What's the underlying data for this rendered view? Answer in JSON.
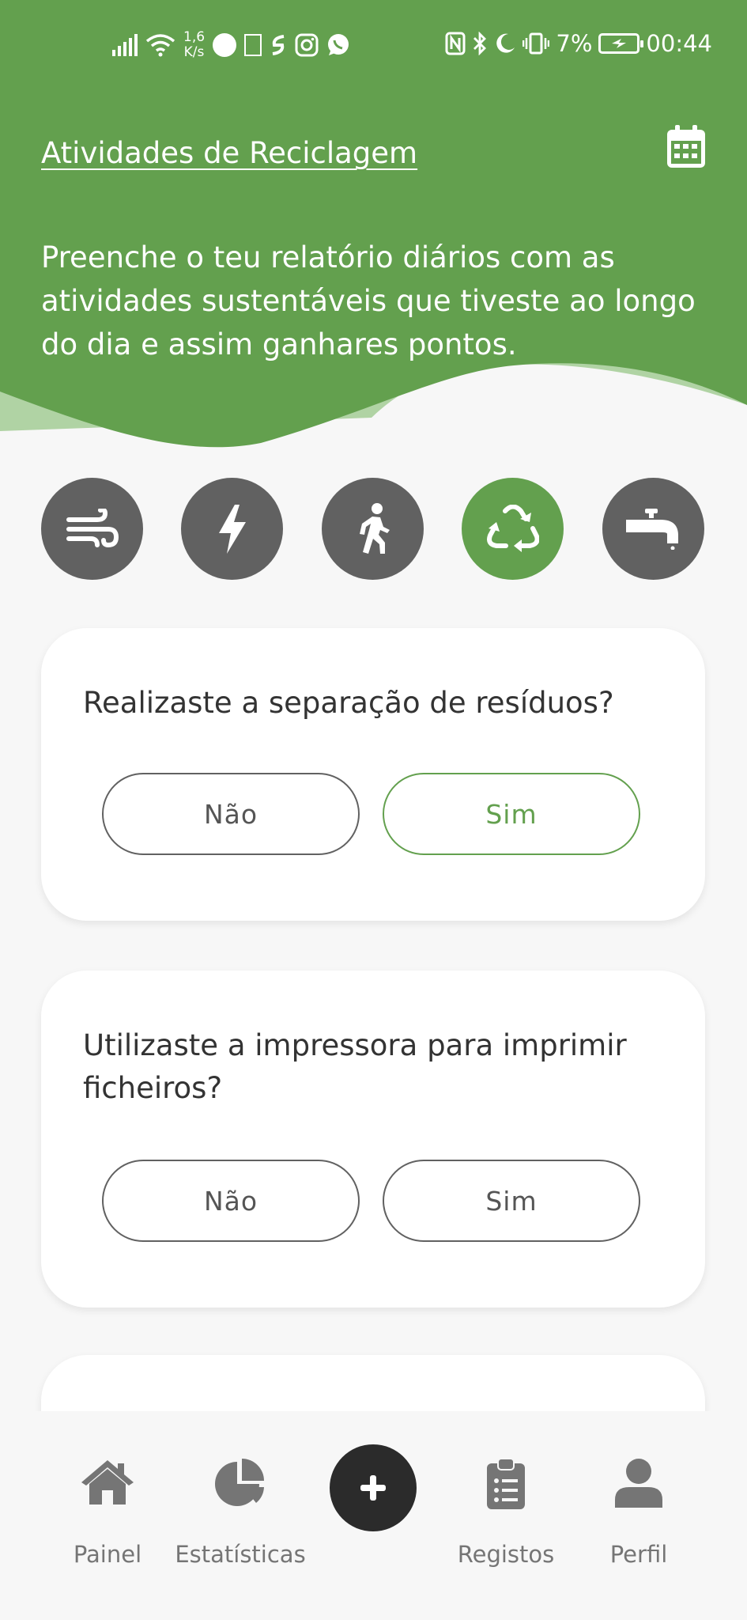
{
  "status_bar": {
    "net_speed_value": "1,6",
    "net_speed_unit": "K/s",
    "battery": "7%",
    "time": "00:44"
  },
  "header": {
    "title": "Atividades de Reciclagem",
    "subtitle": "Preenche o teu relatório diários com as atividades sustentáveis que tiveste ao longo do dia e assim ganhares pontos.",
    "calendar_icon": "calendar-icon"
  },
  "categories": [
    {
      "icon": "wind-icon",
      "active": false
    },
    {
      "icon": "lightning-icon",
      "active": false
    },
    {
      "icon": "walking-icon",
      "active": false
    },
    {
      "icon": "recycle-icon",
      "active": true
    },
    {
      "icon": "faucet-icon",
      "active": false
    }
  ],
  "questions": [
    {
      "text": "Realizaste a separação de resíduos?",
      "no": "Não",
      "yes": "Sim",
      "selected": "yes"
    },
    {
      "text": "Utilizaste a impressora para imprimir ficheiros?",
      "no": "Não",
      "yes": "Sim",
      "selected": null
    }
  ],
  "nav": {
    "items": [
      {
        "label": "Painel",
        "icon": "home-icon"
      },
      {
        "label": "Estatísticas",
        "icon": "pie-chart-icon"
      },
      {
        "label": "",
        "icon": "plus-icon"
      },
      {
        "label": "Registos",
        "icon": "clipboard-list-icon"
      },
      {
        "label": "Perfil",
        "icon": "user-icon"
      }
    ]
  },
  "colors": {
    "primary_green": "#63a04e",
    "light_green": "#b0d3a4",
    "icon_gray": "#616161",
    "fab_dark": "#2b2b2b"
  }
}
